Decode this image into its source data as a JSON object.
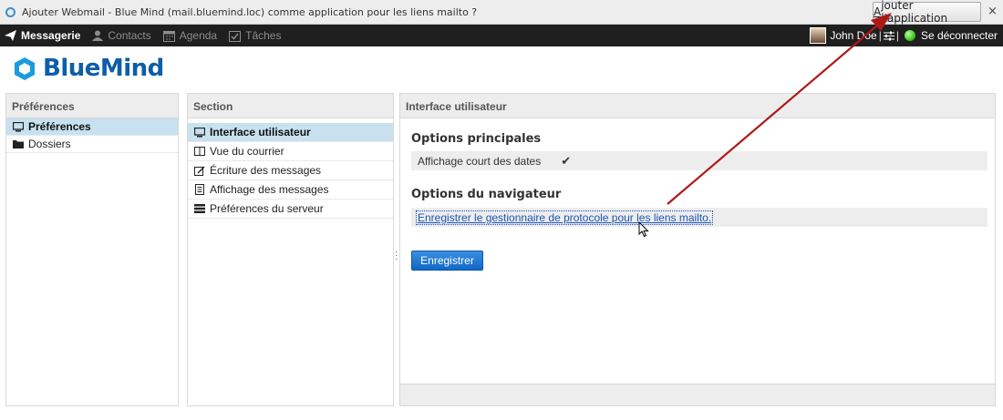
{
  "notification": {
    "text": "Ajouter Webmail - Blue Mind (mail.bluemind.loc) comme application pour les liens mailto ?",
    "button_underlined": "A",
    "button_rest": "jouter l'application",
    "close_label": "×"
  },
  "nav": {
    "items": [
      {
        "label": "Messagerie",
        "icon": "send-icon",
        "active": true
      },
      {
        "label": "Contacts",
        "icon": "user-icon",
        "active": false
      },
      {
        "label": "Agenda",
        "icon": "calendar-icon",
        "active": false
      },
      {
        "label": "Tâches",
        "icon": "task-icon",
        "active": false
      }
    ],
    "user_name": "John Doe",
    "separator": "|",
    "logout_label": "Se déconnecter"
  },
  "logo": {
    "text": "BlueMind"
  },
  "prefs_panel": {
    "title": "Préférences",
    "items": [
      {
        "label": "Préférences",
        "icon": "monitor-icon",
        "selected": true
      },
      {
        "label": "Dossiers",
        "icon": "folder-icon",
        "selected": false
      }
    ]
  },
  "section_panel": {
    "title": "Section",
    "items": [
      {
        "label": "Interface utilisateur",
        "icon": "monitor-icon",
        "selected": true
      },
      {
        "label": "Vue du courrier",
        "icon": "columns-icon",
        "selected": false
      },
      {
        "label": "Écriture des messages",
        "icon": "edit-icon",
        "selected": false
      },
      {
        "label": "Affichage des messages",
        "icon": "document-icon",
        "selected": false
      },
      {
        "label": "Préférences du serveur",
        "icon": "server-icon",
        "selected": false
      }
    ]
  },
  "main_panel": {
    "title": "Interface utilisateur",
    "group1_title": "Options principales",
    "short_dates_label": "Affichage court des dates",
    "short_dates_checked": true,
    "group2_title": "Options du navigateur",
    "protocol_link": "Enregistrer le gestionnaire de protocole pour les liens mailto.",
    "save_label": "Enregistrer"
  },
  "colors": {
    "accent": "#0d5ea8",
    "selection": "#c7e1ef",
    "annotation_arrow": "#b01818"
  }
}
